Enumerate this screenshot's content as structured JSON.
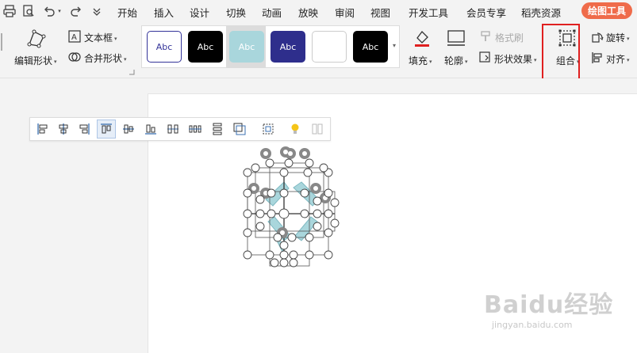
{
  "menubar": {
    "quick_icons": [
      "print-icon",
      "print-preview-icon",
      "undo-icon",
      "redo-icon",
      "customize-dropdown-icon"
    ],
    "items": [
      "开始",
      "插入",
      "设计",
      "切换",
      "动画",
      "放映",
      "审阅",
      "视图",
      "开发工具",
      "会员专享",
      "稻壳资源"
    ],
    "tool_tab": "绘图工具"
  },
  "ribbon": {
    "edit_shape": "编辑形状",
    "text_box": "文本框",
    "merge_shape": "合并形状",
    "style_presets": [
      {
        "label": "Abc",
        "bg": "#ffffff",
        "fg": "#333399",
        "border": "#333399"
      },
      {
        "label": "Abc",
        "bg": "#000000",
        "fg": "#ffffff",
        "border": "#000000"
      },
      {
        "label": "Abc",
        "bg": "#a9d6dc",
        "fg": "#ffffff",
        "border": "#a9d6dc"
      },
      {
        "label": "Abc",
        "bg": "#2e2e8c",
        "fg": "#ffffff",
        "border": "#2e2e8c"
      },
      {
        "label": "",
        "bg": "#ffffff",
        "fg": "#333333",
        "border": "#cccccc"
      },
      {
        "label": "Abc",
        "bg": "#000000",
        "fg": "#ffffff",
        "border": "#000000"
      }
    ],
    "fill": "填充",
    "outline": "轮廓",
    "format_painter": "格式刷",
    "shape_effects": "形状效果",
    "group": "组合",
    "rotate": "旋转",
    "align": "对齐"
  },
  "align_toolbar": {
    "buttons": [
      "align-left-icon",
      "align-center-icon",
      "align-right-icon",
      "align-top-icon",
      "align-middle-icon",
      "align-bottom-icon",
      "distribute-horizontal-icon",
      "distribute-horizontal-space-icon",
      "distribute-vertical-icon",
      "slide-fit-icon",
      "group-icon",
      "lightbulb-icon",
      "more-icon"
    ],
    "active_index": 3
  },
  "watermark": {
    "text": "Baidu经验",
    "url": "jingyan.baidu.com"
  },
  "colors": {
    "accent_tab": "#ef6b4a",
    "highlight_border": "#e02020",
    "shape_fill": "#a9d6dc"
  }
}
